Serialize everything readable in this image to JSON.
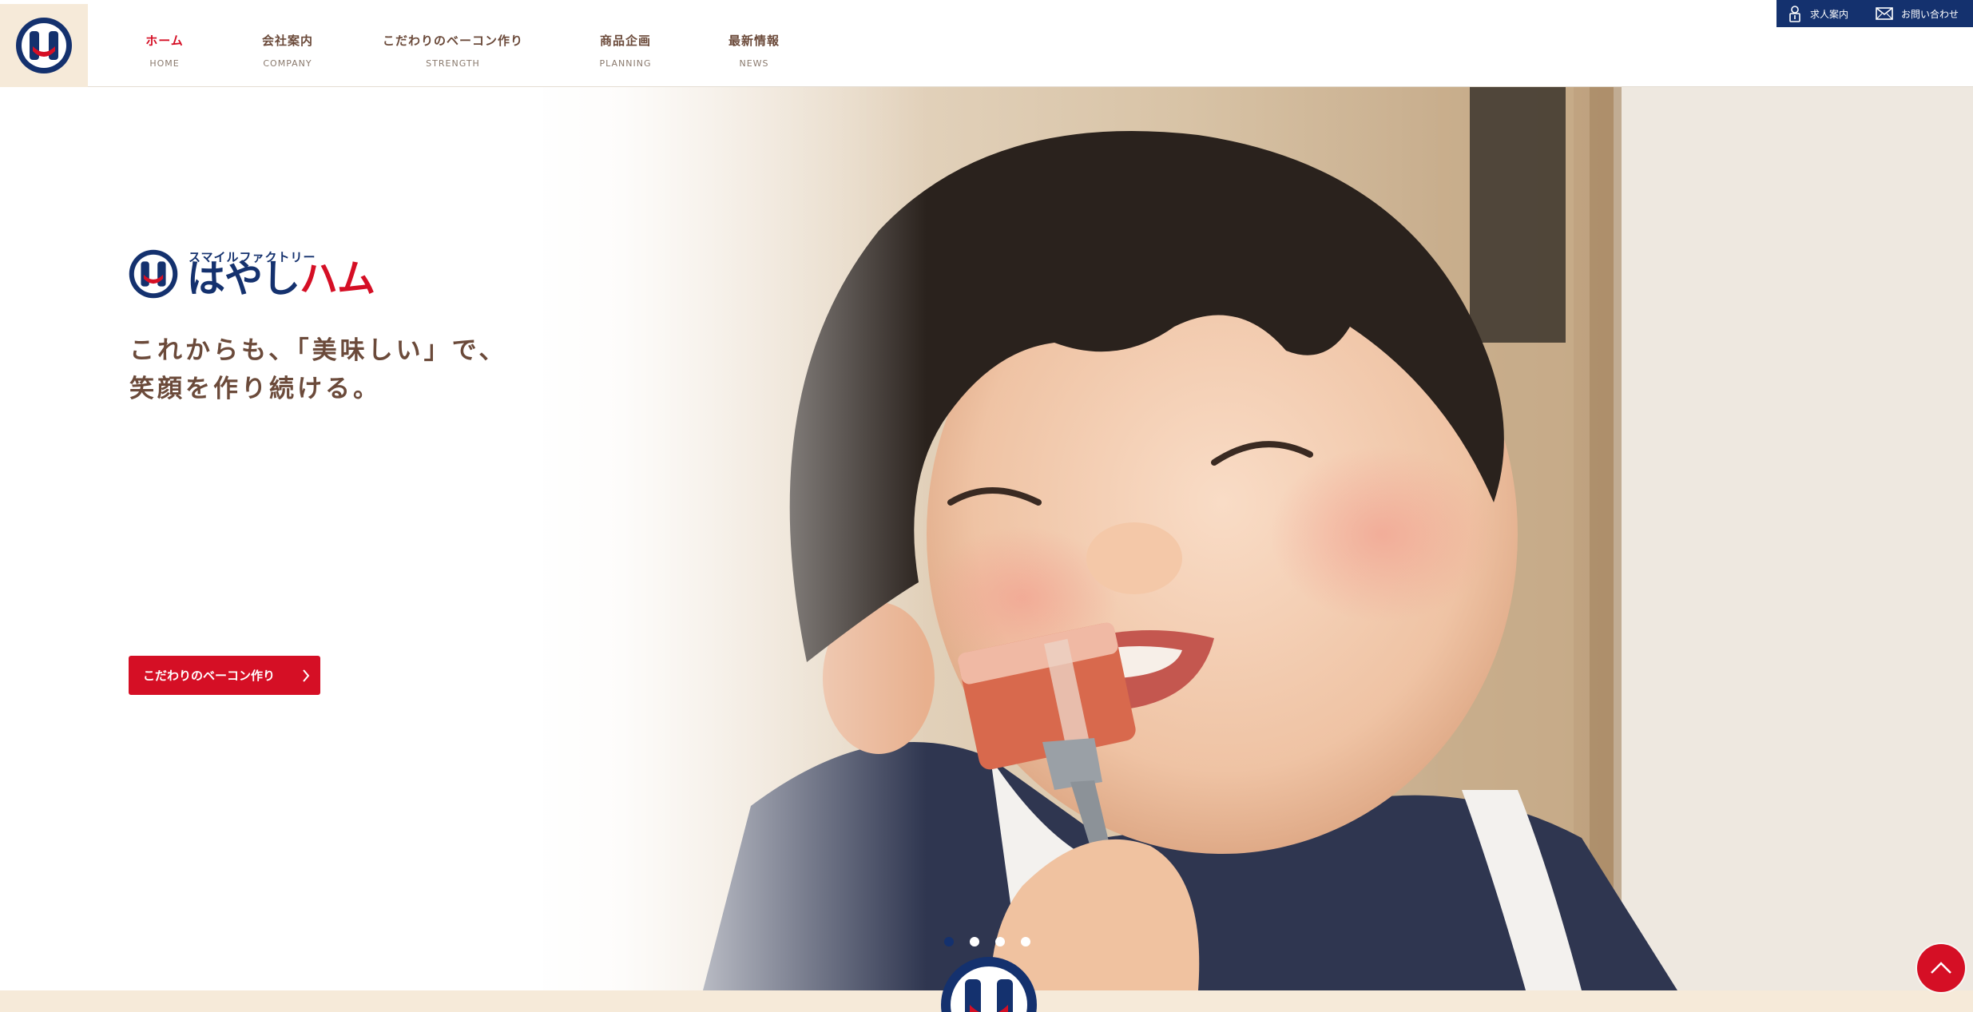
{
  "header": {
    "nav": [
      {
        "label": "ホーム",
        "sublabel": "HOME"
      },
      {
        "label": "会社案内",
        "sublabel": "COMPANY"
      },
      {
        "label": "こだわりのベーコン作り",
        "sublabel": "STRENGTH"
      },
      {
        "label": "商品企画",
        "sublabel": "PLANNING"
      },
      {
        "label": "最新情報",
        "sublabel": "NEWS"
      }
    ],
    "utility": {
      "recruit_label": "求人案内",
      "contact_label": "お問い合わせ"
    }
  },
  "hero": {
    "brand_kana": "スマイルファクトリー",
    "brand_name_blue": "はやし",
    "brand_name_red": "ハム",
    "tagline_line1": "これからも、「美味しい」で、",
    "tagline_line2": "笑顔を作り続ける。",
    "cta_label": "こだわりのベーコン作り",
    "slider": {
      "count": 4,
      "active": 1
    }
  },
  "colors": {
    "navy": "#14316e",
    "red": "#d50f25",
    "brown_text": "#6b4a3a",
    "beige": "#f6ead9"
  },
  "icons": {
    "logo": "hayashi-ham-logo-icon",
    "recruit": "person-badge-icon",
    "contact": "envelope-icon",
    "cta": "chevron-right-icon",
    "back_to_top": "chevron-up-icon"
  }
}
